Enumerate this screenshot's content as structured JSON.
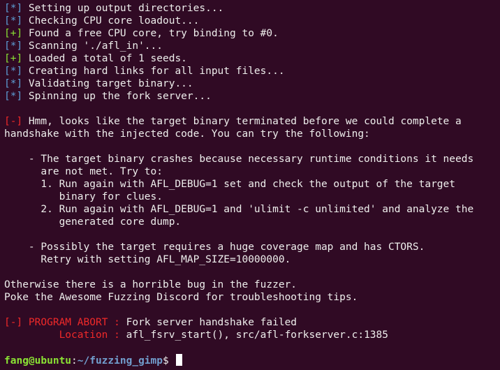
{
  "terminal": {
    "status_lines": [
      {
        "tag": "[*]",
        "type": "info",
        "text": " Setting up output directories..."
      },
      {
        "tag": "[*]",
        "type": "info",
        "text": " Checking CPU core loadout..."
      },
      {
        "tag": "[+]",
        "type": "ok",
        "text": " Found a free CPU core, try binding to #0."
      },
      {
        "tag": "[*]",
        "type": "info",
        "text": " Scanning './afl_in'..."
      },
      {
        "tag": "[+]",
        "type": "ok",
        "text": " Loaded a total of 1 seeds."
      },
      {
        "tag": "[*]",
        "type": "info",
        "text": " Creating hard links for all input files..."
      },
      {
        "tag": "[*]",
        "type": "info",
        "text": " Validating target binary..."
      },
      {
        "tag": "[*]",
        "type": "info",
        "text": " Spinning up the fork server..."
      }
    ],
    "error": {
      "tag": "[-]",
      "line1": " Hmm, looks like the target binary terminated before we could complete a",
      "line2": "handshake with the injected code. You can try the following:"
    },
    "body_lines": [
      "    - The target binary crashes because necessary runtime conditions it needs",
      "      are not met. Try to:",
      "      1. Run again with AFL_DEBUG=1 set and check the output of the target",
      "         binary for clues.",
      "      2. Run again with AFL_DEBUG=1 and 'ulimit -c unlimited' and analyze the",
      "         generated core dump.",
      "",
      "    - Possibly the target requires a huge coverage map and has CTORS.",
      "      Retry with setting AFL_MAP_SIZE=10000000.",
      "",
      "Otherwise there is a horrible bug in the fuzzer.",
      "Poke the Awesome Fuzzing Discord for troubleshooting tips."
    ],
    "abort": {
      "tag": "[-]",
      "label": " PROGRAM ABORT : ",
      "message": "Fork server handshake failed",
      "location_label": "         Location : ",
      "location_value": "afl_fsrv_start(), src/afl-forkserver.c:1385"
    },
    "prompt": {
      "user_host": "fang@ubuntu",
      "colon": ":",
      "path": "~/fuzzing_gimp",
      "symbol": "$ "
    }
  },
  "colors": {
    "background": "#300a24",
    "info_tag": "#5d9fd6",
    "ok_tag": "#8ae234",
    "error_red": "#ef2929",
    "text": "#eeeeec"
  }
}
